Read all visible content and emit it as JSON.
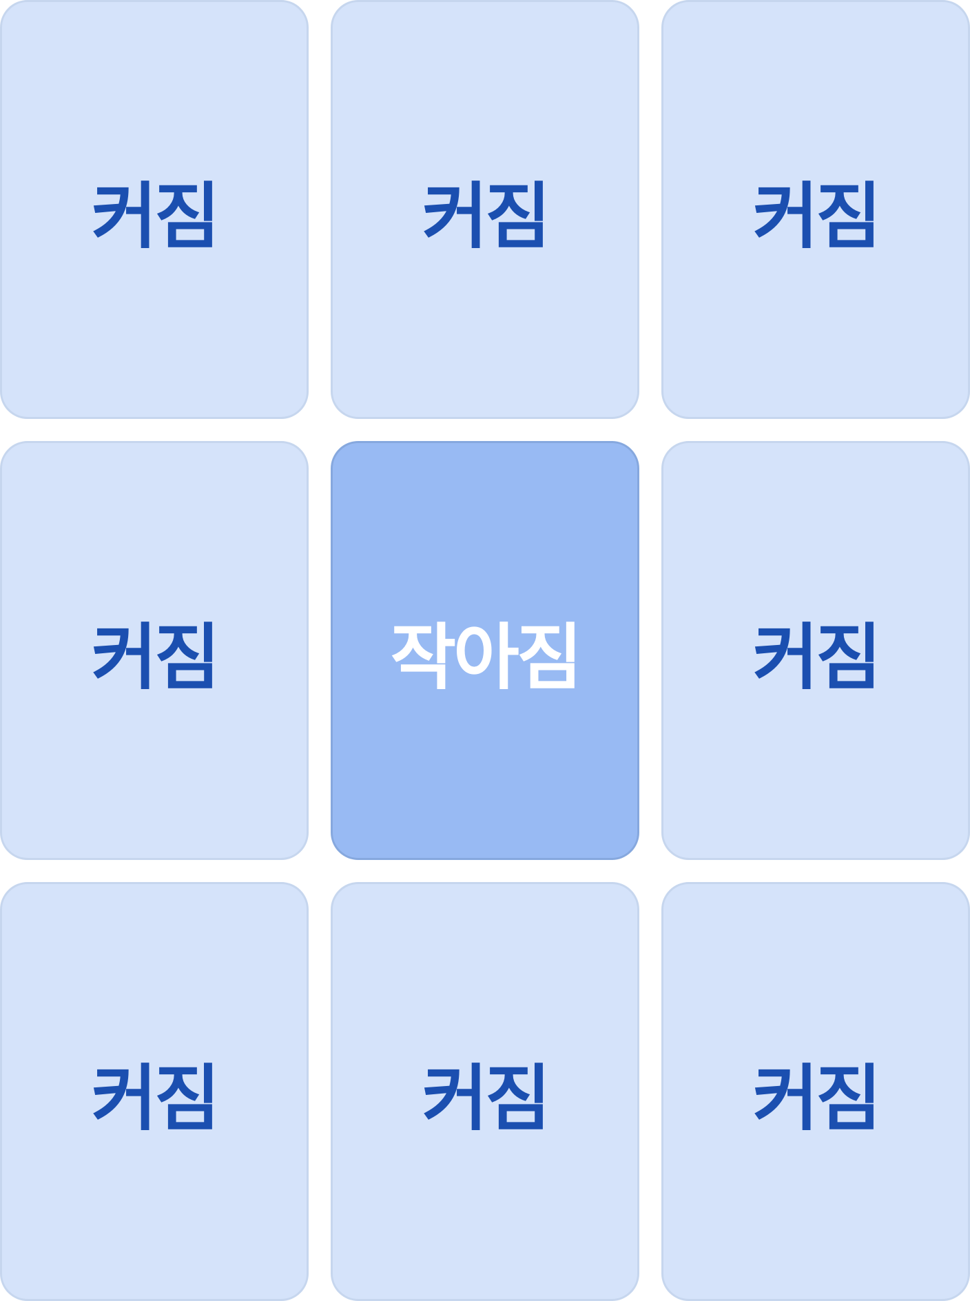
{
  "grid": {
    "tiles": [
      {
        "label": "커짐",
        "state": "off"
      },
      {
        "label": "커짐",
        "state": "off"
      },
      {
        "label": "커짐",
        "state": "off"
      },
      {
        "label": "커짐",
        "state": "off"
      },
      {
        "label": "작아짐",
        "state": "on"
      },
      {
        "label": "커짐",
        "state": "off"
      },
      {
        "label": "커짐",
        "state": "off"
      },
      {
        "label": "커짐",
        "state": "off"
      },
      {
        "label": "커짐",
        "state": "off"
      }
    ]
  },
  "colors": {
    "tile_bg": "#d5e3fa",
    "tile_border": "#c6d6ee",
    "tile_active_bg": "#98baf3",
    "tile_active_border": "#86a8de",
    "label_text": "#1b4fb0",
    "label_active_text": "#ffffff"
  }
}
